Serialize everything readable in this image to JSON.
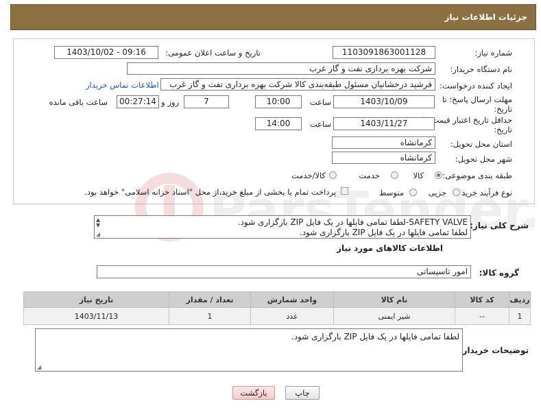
{
  "header": {
    "title": "جزئیات اطلاعات نیاز"
  },
  "fields": {
    "need_number_label": "شماره نیاز:",
    "need_number": "1103091863001128",
    "announce_label": "تاریخ و ساعت اعلان عمومی:",
    "announce_value": "1403/10/02 - 09:16",
    "buyer_org_label": "نام دستگاه خریدار:",
    "buyer_org": "شرکت بهره برداری نفت و گاز غرب",
    "creator_label": "ایجاد کننده درخواست:",
    "creator": "فرشید درخشانیان مسئول طبقه‌بندی کالا شرکت بهره برداری نفت و گاز غرب",
    "contact_link": "اطلاعات تماس خریدار",
    "deadline_label": "مهلت ارسال پاسخ: تا",
    "deadline_label2": "تاریخ:",
    "deadline_date": "1403/10/09",
    "time_label": "ساعت",
    "deadline_time": "10:00",
    "days_value": "7",
    "days_label": "روز و",
    "remaining_time": "00:27:14",
    "remaining_label": "ساعت باقی مانده",
    "price_validity_label": "حداقل تاریخ اعتبار قیمت: تا",
    "price_validity_label2": "تاریخ:",
    "price_validity_date": "1403/11/27",
    "price_validity_time": "14:00",
    "province_label": "استان محل تحویل:",
    "province": "کرمانشاه",
    "city_label": "شهر محل تحویل:",
    "city": "کرمانشاه",
    "category_label": "طبقه بندی موضوعی:",
    "category_options": [
      "کالا",
      "خدمت",
      "کالا/خدمت"
    ],
    "process_label": "نوع فرآیند خرید :",
    "process_options": [
      "جزیی",
      "متوسط"
    ],
    "payment_note": "پرداخت تمام یا بخشی از مبلغ خرید،از محل \"اسناد خزانه اسلامی\" خواهد بود."
  },
  "description": {
    "label": "شرح کلی نیاز:",
    "line1": "SAFETY VALVE-لطفا تمامی فایلها در یک فایل ZIP بارگزاری شود.",
    "line2": "لطفا تمامی فایلها در یک فایل ZIP بارگزاری شود."
  },
  "goods": {
    "section_title": "اطلاعات کالاهای مورد نیاز",
    "group_label": "گروه کالا:",
    "group_value": "امور تاسیساتی",
    "columns": [
      "ردیف",
      "کد کالا",
      "نام کالا",
      "واحد شمارش",
      "تعداد / مقدار",
      "تاریخ نیاز"
    ],
    "rows": [
      {
        "row": "1",
        "code": "--",
        "name": "شیر ایمنی",
        "unit": "عدد",
        "qty": "1",
        "date": "1403/11/13"
      }
    ]
  },
  "buyer_notes": {
    "label": "توضیحات خریدار:",
    "text": "لطفا تمامی فایلها در یک فایل ZIP بارگزاری شود."
  },
  "buttons": {
    "print": "چاپ",
    "back": "بازگشت"
  },
  "watermark": {
    "text": "ParsTender.net"
  }
}
